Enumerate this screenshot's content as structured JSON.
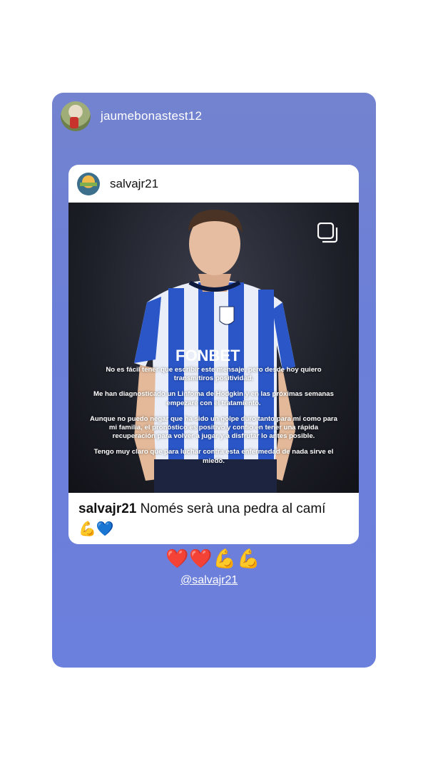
{
  "story": {
    "username": "jaumebonastest12",
    "sticker_emojis": "❤️❤️💪💪",
    "mention": "@salvajr21"
  },
  "post": {
    "username": "salvajr21",
    "overlay_paragraphs": [
      "No es fácil tener que escribir este mensaje, pero desde hoy quiero transmitiros positividad.",
      "Me han diagnosticado un Linfoma de Hodgkin y en las próximas semanas empezaré con el tratamiento.",
      "Aunque no puedo negar que ha sido un golpe duro tanto para mí como para mi familia, el pronóstico es positivo y confío en tener una rápida recuperación para volver a jugar y a disfrutar lo antes posible.",
      "Tengo muy claro que para luchar contra esta enfermedad de nada sirve el miedo."
    ],
    "jersey_sponsor": "FONBET",
    "caption_user": "salvajr21",
    "caption_text": "Només serà una pedra al camí",
    "caption_emojis": "💪💙"
  },
  "icons": {
    "carousel": "carousel-icon"
  },
  "colors": {
    "story_bg": "#6c7fd8",
    "jersey_blue": "#2a56c7"
  }
}
